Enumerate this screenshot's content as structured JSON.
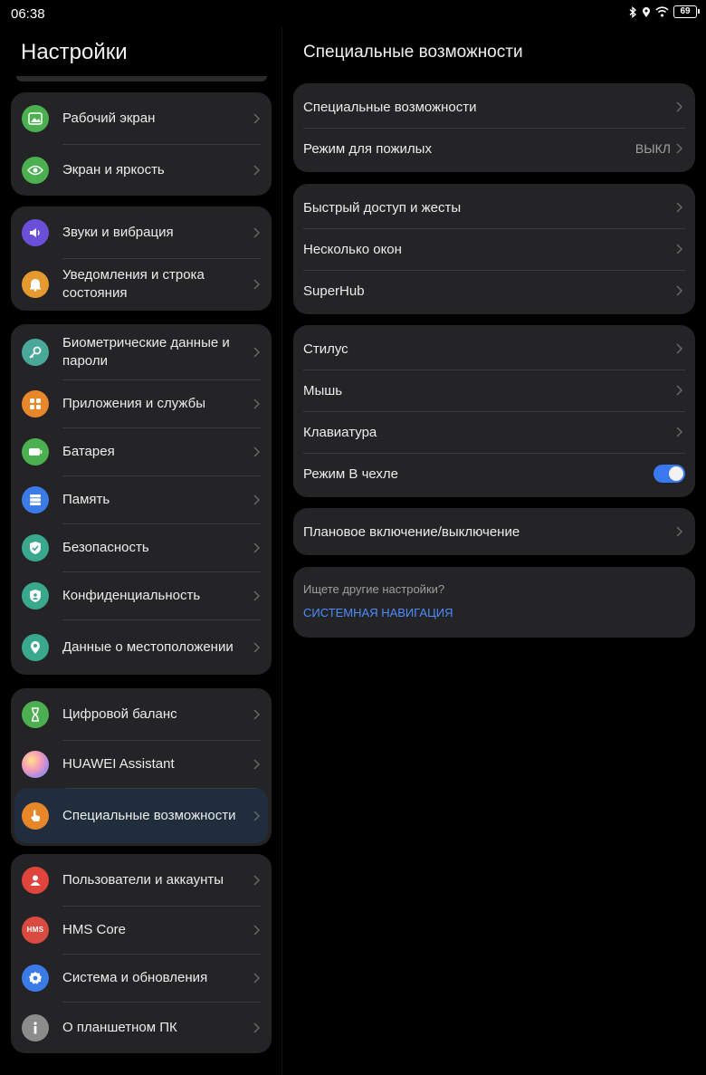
{
  "status": {
    "time": "06:38",
    "battery": "69"
  },
  "left": {
    "title": "Настройки",
    "groups": [
      [
        {
          "label": "Рабочий экран",
          "icon": "wallpaper-icon",
          "color": "#4caf50"
        },
        {
          "label": "Экран и яркость",
          "icon": "eye-icon",
          "color": "#4caf50"
        }
      ],
      [
        {
          "label": "Звуки и вибрация",
          "icon": "speaker-icon",
          "color": "#6a4fd8"
        },
        {
          "label": "Уведомления и строка состояния",
          "icon": "bell-icon",
          "color": "#e49a2e"
        }
      ],
      [
        {
          "label": "Биометрические данные и пароли",
          "icon": "key-icon",
          "color": "#4aa89a"
        },
        {
          "label": "Приложения и службы",
          "icon": "apps-icon",
          "color": "#e8862a"
        },
        {
          "label": "Батарея",
          "icon": "battery-icon",
          "color": "#4caf50"
        },
        {
          "label": "Память",
          "icon": "storage-icon",
          "color": "#3b7be8"
        },
        {
          "label": "Безопасность",
          "icon": "shield-check-icon",
          "color": "#3aa88c"
        },
        {
          "label": "Конфиденциальность",
          "icon": "privacy-shield-icon",
          "color": "#3aa88c"
        },
        {
          "label": "Данные о местоположении",
          "icon": "location-icon",
          "color": "#3aa88c"
        }
      ],
      [
        {
          "label": "Цифровой баланс",
          "icon": "hourglass-icon",
          "color": "#4caf50"
        },
        {
          "label": "HUAWEI Assistant",
          "icon": "assistant-icon",
          "color": "#c46fd6"
        },
        {
          "label": "Специальные возможности",
          "icon": "hand-icon",
          "color": "#e8862a"
        }
      ],
      [
        {
          "label": "Пользователи и аккаунты",
          "icon": "user-icon",
          "color": "#e0443c"
        },
        {
          "label": "HMS Core",
          "icon": "hms-icon",
          "color": "#d94a40",
          "icon_text": "HMS"
        },
        {
          "label": "Система и обновления",
          "icon": "gear-icon",
          "color": "#3b7be8"
        },
        {
          "label": "О планшетном ПК",
          "icon": "info-icon",
          "color": "#8c8c8c"
        }
      ]
    ]
  },
  "right": {
    "title": "Специальные возможности",
    "groups": [
      [
        {
          "label": "Специальные возможности"
        },
        {
          "label": "Режим для пожилых",
          "value": "ВЫКЛ"
        }
      ],
      [
        {
          "label": "Быстрый доступ и жесты"
        },
        {
          "label": "Несколько окон"
        },
        {
          "label": "SuperHub"
        }
      ],
      [
        {
          "label": "Стилус"
        },
        {
          "label": "Мышь"
        },
        {
          "label": "Клавиатура"
        },
        {
          "label": "Режим В чехле",
          "toggle": true
        }
      ],
      [
        {
          "label": "Плановое включение/выключение"
        }
      ]
    ],
    "hint": {
      "question": "Ищете другие настройки?",
      "link": "СИСТЕМНАЯ НАВИГАЦИЯ"
    }
  }
}
